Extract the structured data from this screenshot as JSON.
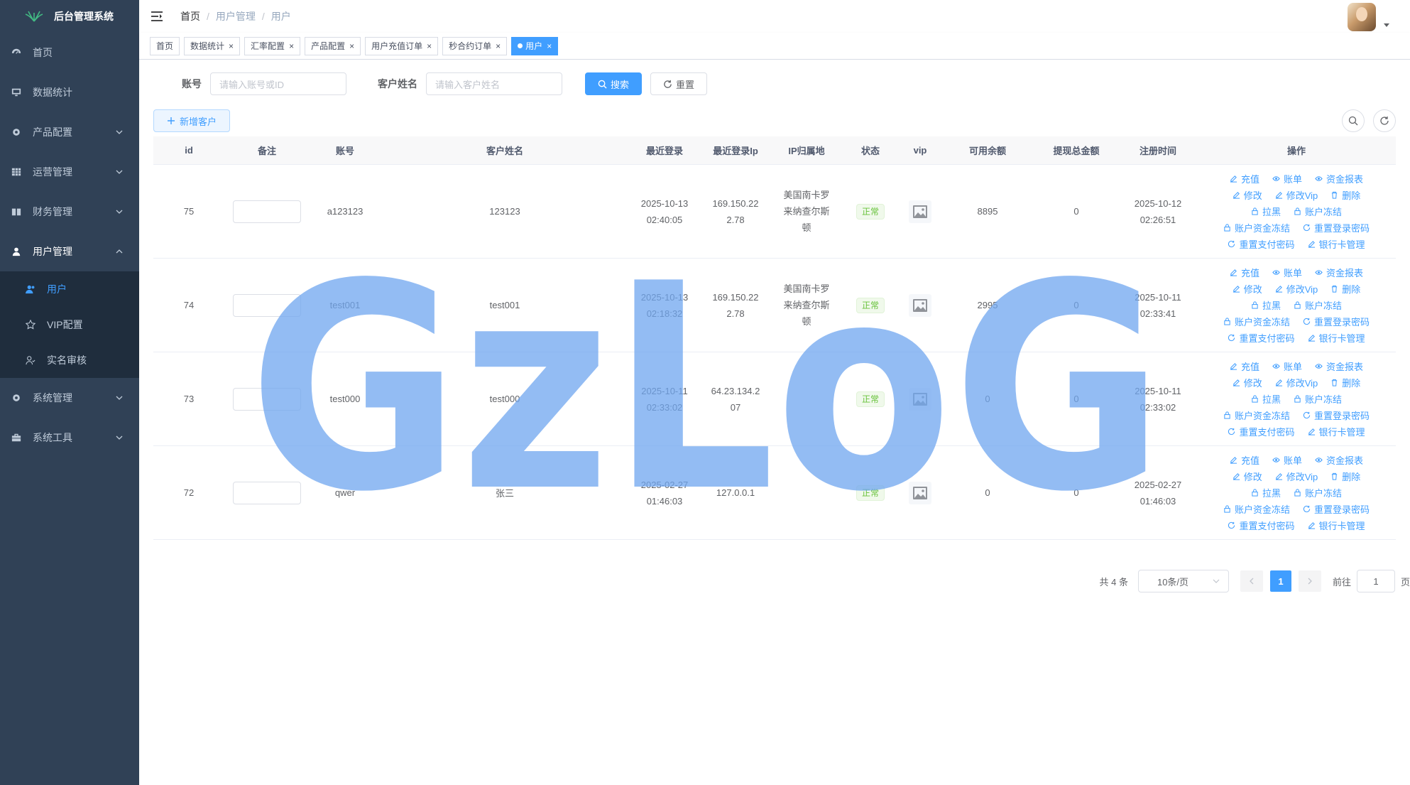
{
  "app": {
    "title": "后台管理系统"
  },
  "sidebar": {
    "items": [
      {
        "label": "首页"
      },
      {
        "label": "数据统计"
      },
      {
        "label": "产品配置"
      },
      {
        "label": "运营管理"
      },
      {
        "label": "财务管理"
      },
      {
        "label": "用户管理"
      },
      {
        "label": "系统管理"
      },
      {
        "label": "系统工具"
      }
    ],
    "submenu": [
      {
        "label": "用户"
      },
      {
        "label": "VIP配置"
      },
      {
        "label": "实名审核"
      }
    ]
  },
  "breadcrumb": [
    "首页",
    "用户管理",
    "用户"
  ],
  "tabs": [
    {
      "label": "首页"
    },
    {
      "label": "数据统计"
    },
    {
      "label": "汇率配置"
    },
    {
      "label": "产品配置"
    },
    {
      "label": "用户充值订单"
    },
    {
      "label": "秒合约订单"
    },
    {
      "label": "用户"
    }
  ],
  "search": {
    "account_label": "账号",
    "account_placeholder": "请输入账号或ID",
    "name_label": "客户姓名",
    "name_placeholder": "请输入客户姓名",
    "search_btn": "搜索",
    "reset_btn": "重置"
  },
  "toolbar": {
    "add_btn": "新增客户"
  },
  "table": {
    "headers": [
      "id",
      "备注",
      "账号",
      "客户姓名",
      "最近登录",
      "最近登录Ip",
      "IP归属地",
      "状态",
      "vip",
      "可用余额",
      "提现总金额",
      "注册时间",
      "操作"
    ],
    "rows": [
      {
        "id": "75",
        "account": "a123123",
        "name": "123123",
        "login_date": "2025-10-13",
        "login_time": "02:40:05",
        "ip1": "169.150.22",
        "ip2": "2.78",
        "loc1": "美国南卡罗",
        "loc2": "来纳查尔斯",
        "loc3": "顿",
        "status": "正常",
        "balance": "8895",
        "withdraw": "0",
        "reg_date": "2025-10-12",
        "reg_time": "02:26:51"
      },
      {
        "id": "74",
        "account": "test001",
        "name": "test001",
        "login_date": "2025-10-13",
        "login_time": "02:18:32",
        "ip1": "169.150.22",
        "ip2": "2.78",
        "loc1": "美国南卡罗",
        "loc2": "来纳查尔斯",
        "loc3": "顿",
        "status": "正常",
        "balance": "2995",
        "withdraw": "0",
        "reg_date": "2025-10-11",
        "reg_time": "02:33:41"
      },
      {
        "id": "73",
        "account": "test000",
        "name": "test000",
        "login_date": "2025-10-11",
        "login_time": "02:33:02",
        "ip1": "64.23.134.2",
        "ip2": "07",
        "loc1": "",
        "loc2": "",
        "loc3": "",
        "status": "正常",
        "balance": "0",
        "withdraw": "0",
        "reg_date": "2025-10-11",
        "reg_time": "02:33:02"
      },
      {
        "id": "72",
        "account": "qwer",
        "name": "张三",
        "login_date": "2025-02-27",
        "login_time": "01:46:03",
        "ip1": "127.0.0.1",
        "ip2": "",
        "loc1": "",
        "loc2": "",
        "loc3": "",
        "status": "正常",
        "balance": "0",
        "withdraw": "0",
        "reg_date": "2025-02-27",
        "reg_time": "01:46:03"
      }
    ],
    "ops": {
      "recharge": "充值",
      "bill": "账单",
      "report": "资金报表",
      "edit": "修改",
      "edit_vip": "修改Vip",
      "delete": "删除",
      "blacklist": "拉黑",
      "freeze": "账户冻结",
      "fund_freeze": "账户资金冻结",
      "reset_login": "重置登录密码",
      "reset_pay": "重置支付密码",
      "bank_card": "银行卡管理"
    }
  },
  "pagination": {
    "total": "共 4 条",
    "page_size": "10条/页",
    "current": "1",
    "goto_label": "前往",
    "goto_value": "1",
    "page_suffix": "页"
  },
  "watermark": {
    "text": "GzLoG"
  },
  "colors": {
    "primary": "#409eff",
    "sidebar_bg": "#304156",
    "submenu_bg": "#1f2d3d",
    "success": "#67c23a",
    "watermark": "#6fa5ef"
  }
}
